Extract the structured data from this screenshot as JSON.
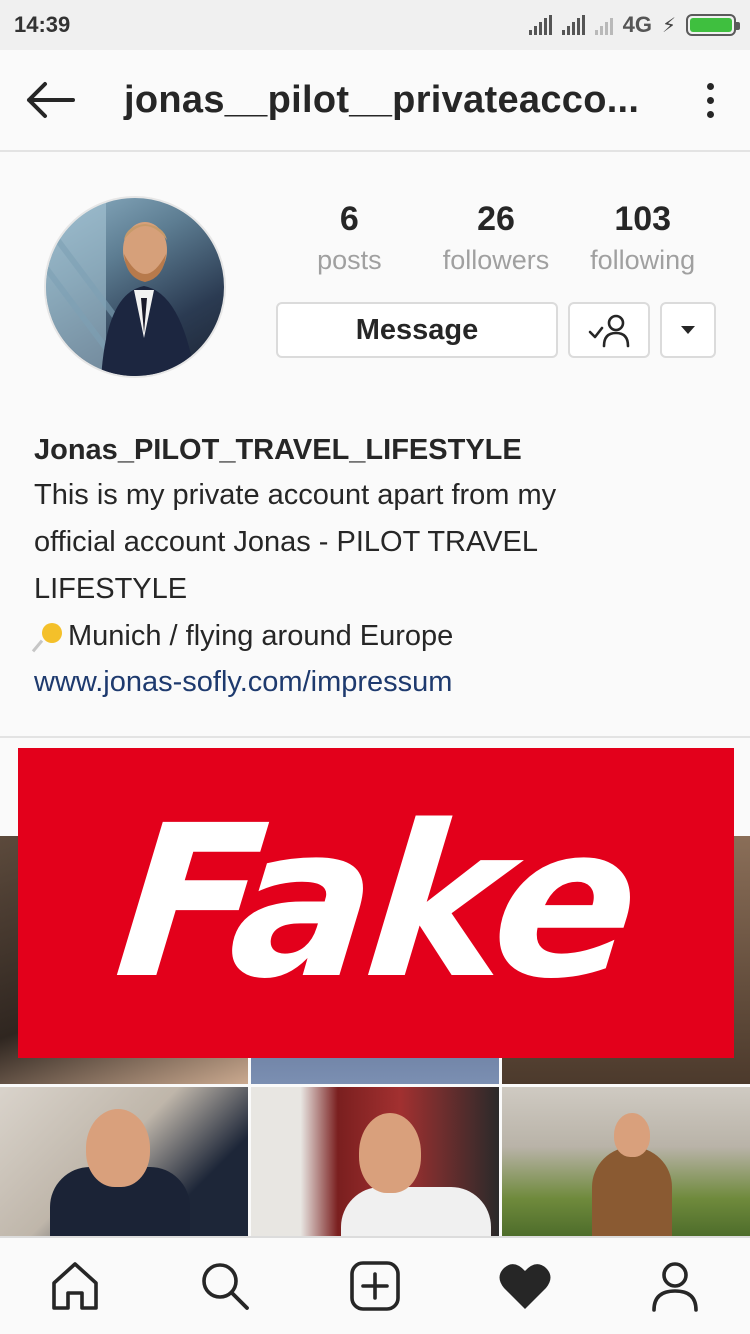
{
  "status_bar": {
    "time": "14:39",
    "network": "4G",
    "battery_level": 1.0,
    "battery_color": "#3fbf3f",
    "icons": [
      "signal-icon",
      "signal-icon",
      "signal-muted-icon",
      "charging-icon",
      "battery-icon"
    ]
  },
  "header": {
    "title": "jonas__pilot__privateacco...",
    "back_icon": "arrow-left-icon",
    "more_icon": "more-vertical-icon"
  },
  "profile": {
    "stats": [
      {
        "value": "6",
        "label": "posts"
      },
      {
        "value": "26",
        "label": "followers"
      },
      {
        "value": "103",
        "label": "following"
      }
    ],
    "message_label": "Message",
    "follow_icon": "person-check-icon",
    "dropdown_icon": "caret-down-icon"
  },
  "bio": {
    "name": "Jonas_PILOT_TRAVEL_LIFESTYLE",
    "line1": "This is my private account apart from my",
    "line2": "official account Jonas - PILOT TRAVEL",
    "line3": "LIFESTYLE",
    "location": "Munich / flying around Europe",
    "link": "www.jonas-sofly.com/impressum"
  },
  "overlay": {
    "text": "Fake",
    "color": "#e3001b"
  },
  "bottom_nav": {
    "items": [
      {
        "icon": "home-icon"
      },
      {
        "icon": "search-icon"
      },
      {
        "icon": "add-post-icon"
      },
      {
        "icon": "heart-icon"
      },
      {
        "icon": "profile-icon"
      }
    ]
  },
  "colors": {
    "link": "#1e3a6e",
    "muted": "#a0a0a0",
    "text": "#262626"
  }
}
